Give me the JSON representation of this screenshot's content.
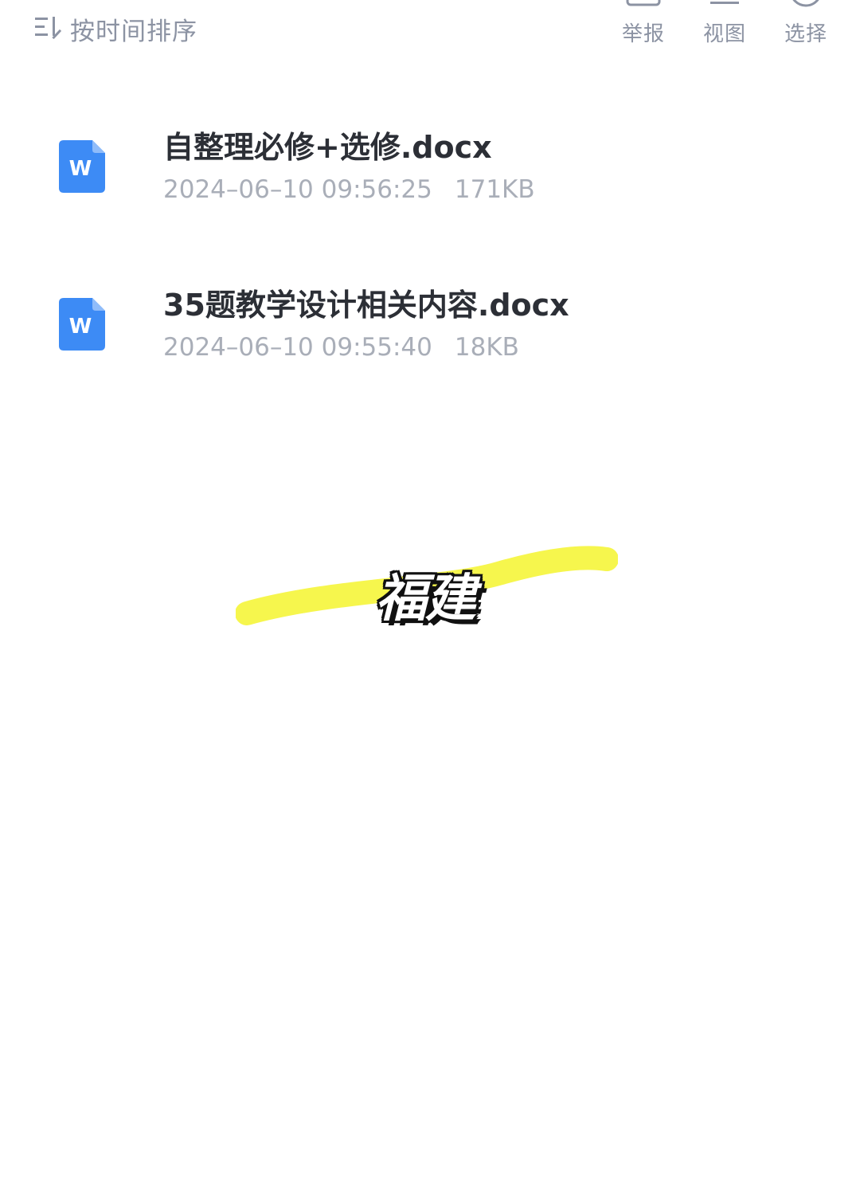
{
  "toolbar": {
    "sort_label": "按时间排序",
    "actions": [
      {
        "label": "举报",
        "icon": "report-icon"
      },
      {
        "label": "视图",
        "icon": "view-icon"
      },
      {
        "label": "选择",
        "icon": "select-icon"
      }
    ]
  },
  "files": [
    {
      "name": "自整理必修+选修.docx",
      "date": "2024–06–10 09:56:25",
      "size": "171KB",
      "icon": "word-doc-icon"
    },
    {
      "name": "35题教学设计相关内容.docx",
      "date": "2024–06–10 09:55:40",
      "size": "18KB",
      "icon": "word-doc-icon"
    }
  ],
  "overlay": {
    "text": "福建",
    "highlight_color": "#f5f53a"
  },
  "colors": {
    "doc_icon_blue": "#3d8bf5",
    "muted_text": "#8c93a3"
  }
}
